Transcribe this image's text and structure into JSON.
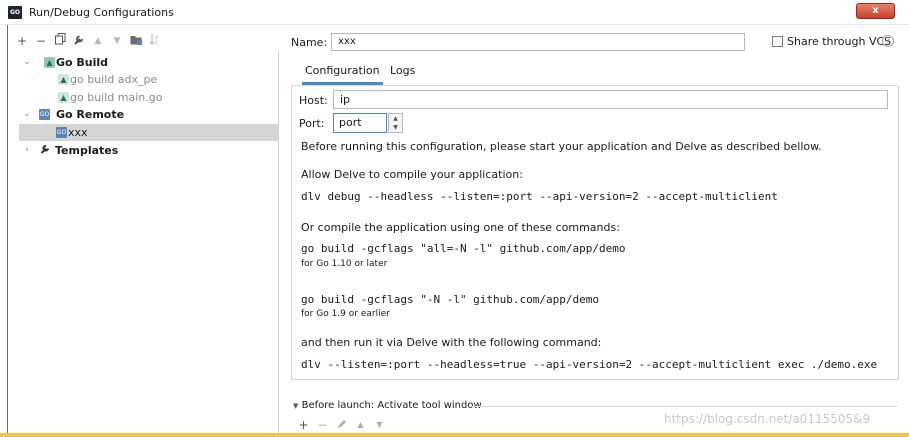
{
  "window": {
    "app_icon": "GO",
    "title": "Run/Debug Configurations",
    "close_label": "x"
  },
  "toolbar": {
    "add": "+",
    "remove": "−",
    "copy": "copy-icon",
    "edit_templates": "wrench-icon",
    "move_up": "▲",
    "move_down": "▼",
    "folder": "folder-icon",
    "sort": "sort-icon"
  },
  "tree": {
    "go_build": "Go Build",
    "go_build_adx": "go build adx_pe",
    "go_build_main": "go build main.go",
    "go_remote": "Go Remote",
    "xxx": "xxx",
    "templates": "Templates"
  },
  "form": {
    "name_label": "Name:",
    "name_value": "xxx",
    "share_label": "Share through VCS",
    "help": "?"
  },
  "tabs": [
    {
      "label": "Configuration"
    },
    {
      "label": "Logs"
    }
  ],
  "config": {
    "host_label": "Host:",
    "host_value": "ip",
    "port_label": "Port:",
    "port_value": "port",
    "intro": "Before running this configuration, please start your application and Delve as described bellow.",
    "allow_delve": "Allow Delve to compile your application:",
    "cmd_debug": "dlv debug --headless --listen=:port --api-version=2 --accept-multiclient",
    "or_compile": "Or compile the application using one of these commands:",
    "cmd_build_new": "go build -gcflags \"all=-N -l\" github.com/app/demo",
    "note_new": "for Go 1.10 or later",
    "cmd_build_old": "go build -gcflags \"-N -l\" github.com/app/demo",
    "note_old": "for Go 1.9 or earlier",
    "then_run": "and then run it via Delve with the following command:",
    "cmd_exec": "dlv --listen=:port --headless=true --api-version=2 --accept-multiclient exec ./demo.exe"
  },
  "before_launch": {
    "label": "Before launch: Activate tool window"
  },
  "watermark": "https://blog.csdn.net/a0115505&9"
}
